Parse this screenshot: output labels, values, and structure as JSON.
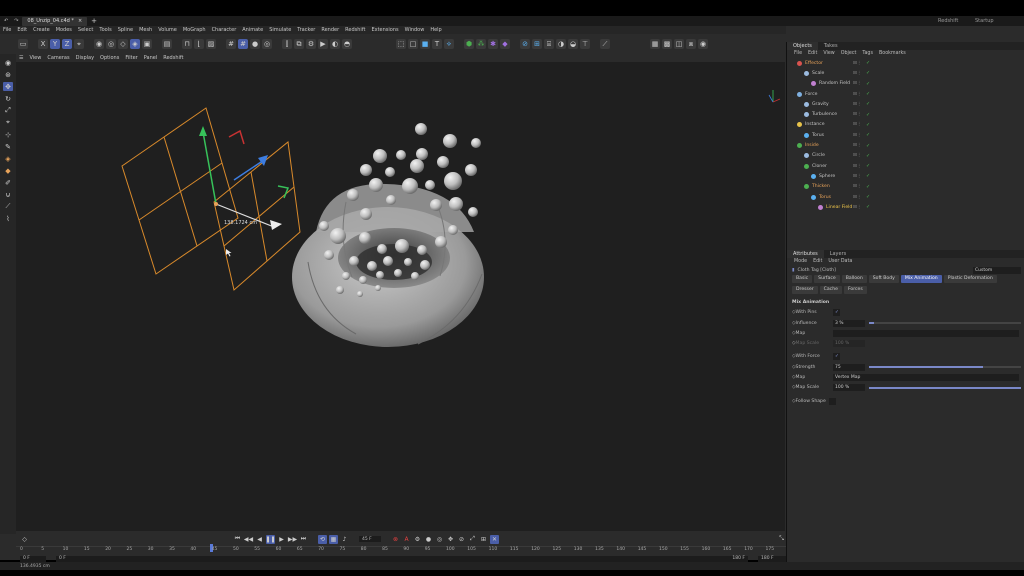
{
  "app": {
    "doc_tab": "08_Unzip_04.c4d *",
    "renderer": "Redshift",
    "layout": "Startup"
  },
  "menu": [
    "File",
    "Edit",
    "Create",
    "Modes",
    "Select",
    "Tools",
    "Spline",
    "Mesh",
    "Volume",
    "MoGraph",
    "Character",
    "Animate",
    "Simulate",
    "Tracker",
    "Render",
    "Redshift",
    "Extensions",
    "Window",
    "Help"
  ],
  "viewport": {
    "menu": [
      "View",
      "Cameras",
      "Display",
      "Options",
      "Filter",
      "Panel",
      "Redshift"
    ],
    "measure": "138.1724 cm"
  },
  "objects": {
    "tabs": [
      "Objects",
      "Takes"
    ],
    "menu": [
      "File",
      "Edit",
      "View",
      "Object",
      "Tags",
      "Bookmarks"
    ],
    "rows": [
      {
        "name": "Effector",
        "indent": 1,
        "cls": "orange",
        "color": "#d9534f"
      },
      {
        "name": "Scale",
        "indent": 2,
        "cls": "",
        "color": "#9bbbe0"
      },
      {
        "name": "Random Field",
        "indent": 3,
        "cls": "",
        "color": "#c080d0"
      },
      {
        "name": "Force",
        "indent": 1,
        "cls": "",
        "color": "#7fb0e0"
      },
      {
        "name": "Gravity",
        "indent": 2,
        "cls": "",
        "color": "#9bbbe0"
      },
      {
        "name": "Turbulence",
        "indent": 2,
        "cls": "",
        "color": "#9bbbe0"
      },
      {
        "name": "Instance",
        "indent": 1,
        "cls": "",
        "color": "#e8c34a"
      },
      {
        "name": "Torus",
        "indent": 2,
        "cls": "",
        "color": "#5ab0f0"
      },
      {
        "name": "Inside",
        "indent": 1,
        "cls": "orange",
        "color": "#4caf50"
      },
      {
        "name": "Circle",
        "indent": 2,
        "cls": "",
        "color": "#9bbbe0"
      },
      {
        "name": "Cloner",
        "indent": 2,
        "cls": "",
        "color": "#4caf50"
      },
      {
        "name": "Sphere",
        "indent": 3,
        "cls": "",
        "color": "#5ab0f0"
      },
      {
        "name": "Thicken",
        "indent": 2,
        "cls": "orange",
        "color": "#4caf50"
      },
      {
        "name": "Torus",
        "indent": 3,
        "cls": "orange",
        "color": "#5ab0f0"
      },
      {
        "name": "Linear Field",
        "indent": 4,
        "cls": "yellow",
        "color": "#c080d0"
      }
    ]
  },
  "attributes": {
    "tabs": [
      "Attributes",
      "Layers"
    ],
    "menu": [
      "Mode",
      "Edit",
      "User Data"
    ],
    "tag_title": "Cloth Tag [Cloth]",
    "preset": "Custom",
    "tabs_row1": [
      "Basic",
      "Surface",
      "Balloon",
      "Soft Body",
      "Mix Animation",
      "Plastic Deformation"
    ],
    "tabs_row2": [
      "Dresser",
      "Cache",
      "Forces"
    ],
    "section": "Mix Animation",
    "params": [
      {
        "label": "With Pins",
        "value": "✓",
        "type": "check"
      },
      {
        "label": "Influence",
        "value": "3 %",
        "type": "slider",
        "pct": 0.03
      },
      {
        "label": "Map",
        "value": "",
        "type": "field"
      },
      {
        "label": "Map Scale",
        "value": "100 %",
        "type": "dim"
      },
      {
        "label": "With Force",
        "value": "✓",
        "type": "check"
      },
      {
        "label": "Strength",
        "value": "75",
        "type": "slider",
        "pct": 0.75
      },
      {
        "label": "Map",
        "value": "Vertex Map",
        "type": "field"
      },
      {
        "label": "Map Scale",
        "value": "100 %",
        "type": "slider",
        "pct": 1.0
      },
      {
        "label": "Follow Shape",
        "value": "",
        "type": "check"
      }
    ]
  },
  "timeline": {
    "current_frame": "45 F",
    "ticks": [
      "0",
      "5",
      "10",
      "15",
      "20",
      "25",
      "30",
      "35",
      "40",
      "45",
      "50",
      "55",
      "60",
      "65",
      "70",
      "75",
      "80",
      "85",
      "90",
      "95",
      "100",
      "105",
      "110",
      "115",
      "120",
      "125",
      "130",
      "135",
      "140",
      "145",
      "150",
      "155",
      "160",
      "165",
      "170",
      "175",
      "180"
    ],
    "start": "0 F",
    "start2": "0 F",
    "end": "180 F",
    "end2": "180 F"
  },
  "status": "136.4935 cm"
}
